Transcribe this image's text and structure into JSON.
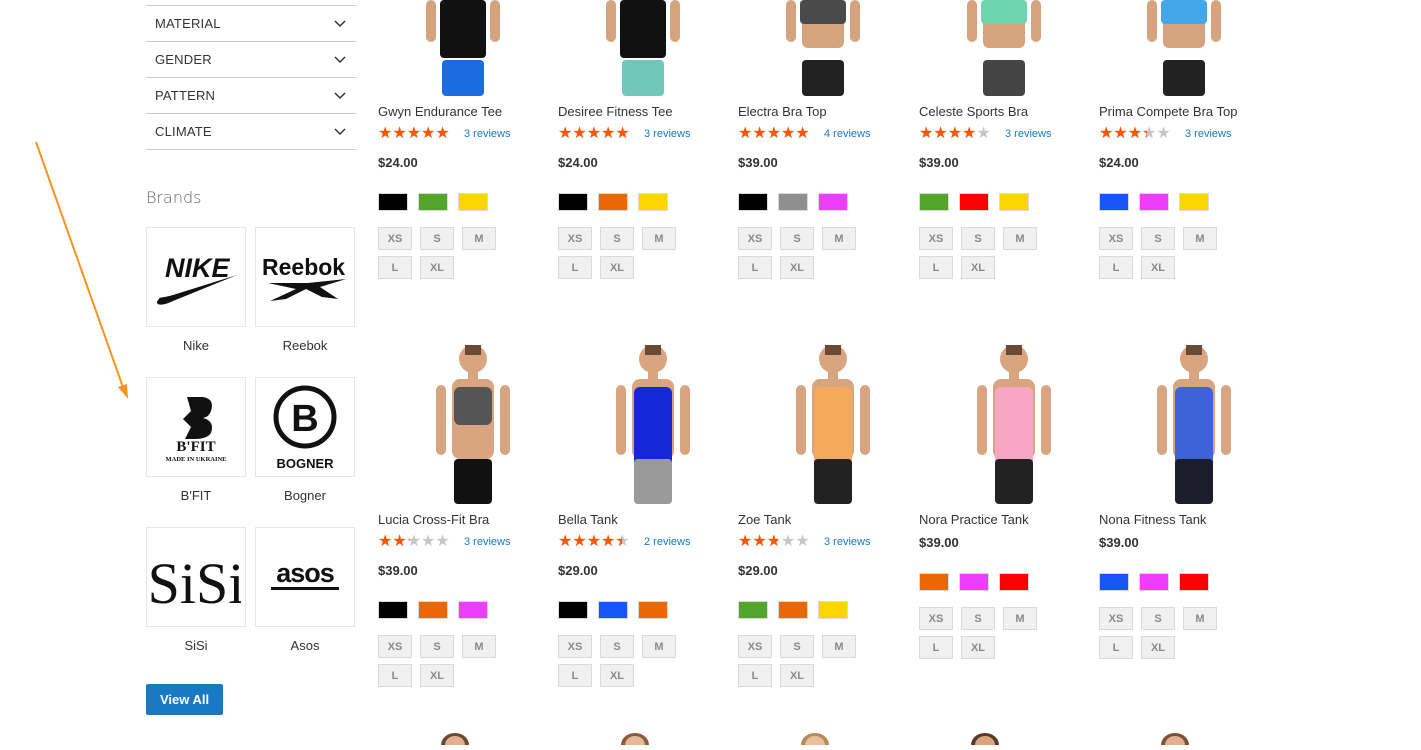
{
  "filters": [
    {
      "label": "MATERIAL"
    },
    {
      "label": "GENDER"
    },
    {
      "label": "PATTERN"
    },
    {
      "label": "CLIMATE"
    }
  ],
  "brands": {
    "title": "Brands",
    "items": [
      {
        "name": "Nike",
        "logo_text": "NIKE"
      },
      {
        "name": "Reebok",
        "logo_text": "Reebok"
      },
      {
        "name": "B'FIT",
        "logo_text": "B'FIT",
        "logo_subtext": "MADE IN UKRAINE"
      },
      {
        "name": "Bogner",
        "logo_text": "BOGNER"
      },
      {
        "name": "SiSi",
        "logo_text": "SiSi"
      },
      {
        "name": "Asos",
        "logo_text": "asos"
      }
    ],
    "view_all": "View All"
  },
  "colors": {
    "accent": "#1979c3",
    "star": "#ff5501",
    "arrow": "#f7931e"
  },
  "products": [
    {
      "name": "Gwyn Endurance Tee",
      "rating": 4.5,
      "reviews": "3 reviews",
      "price": "$24.00",
      "swatches": [
        "#000000",
        "#53a52c",
        "#ffd500"
      ],
      "sizes": [
        "XS",
        "S",
        "M",
        "L",
        "XL"
      ]
    },
    {
      "name": "Desiree Fitness Tee",
      "rating": 4.5,
      "reviews": "3 reviews",
      "price": "$24.00",
      "swatches": [
        "#000000",
        "#eb6703",
        "#ffd500"
      ],
      "sizes": [
        "XS",
        "S",
        "M",
        "L",
        "XL"
      ]
    },
    {
      "name": "Electra Bra Top",
      "rating": 4.5,
      "reviews": "4 reviews",
      "price": "$39.00",
      "swatches": [
        "#000000",
        "#8f8f8f",
        "#ef3dff"
      ],
      "sizes": [
        "XS",
        "S",
        "M",
        "L",
        "XL"
      ]
    },
    {
      "name": "Celeste Sports Bra",
      "rating": 3.5,
      "reviews": "3 reviews",
      "price": "$39.00",
      "swatches": [
        "#53a52c",
        "#ff0000",
        "#ffd500"
      ],
      "sizes": [
        "XS",
        "S",
        "M",
        "L",
        "XL"
      ]
    },
    {
      "name": "Prima Compete Bra Top",
      "rating": 3,
      "reviews": "3 reviews",
      "price": "$24.00",
      "swatches": [
        "#1857f7",
        "#ef3dff",
        "#ffd500"
      ],
      "sizes": [
        "XS",
        "S",
        "M",
        "L",
        "XL"
      ]
    },
    {
      "name": "Lucia Cross-Fit Bra",
      "rating": 2,
      "reviews": "3 reviews",
      "price": "$39.00",
      "swatches": [
        "#000000",
        "#eb6703",
        "#ef3dff"
      ],
      "sizes": [
        "XS",
        "S",
        "M",
        "L",
        "XL"
      ]
    },
    {
      "name": "Bella Tank",
      "rating": 4,
      "reviews": "2 reviews",
      "price": "$29.00",
      "swatches": [
        "#000000",
        "#1857f7",
        "#eb6703"
      ],
      "sizes": [
        "XS",
        "S",
        "M",
        "L",
        "XL"
      ]
    },
    {
      "name": "Zoe Tank",
      "rating": 2.5,
      "reviews": "3 reviews",
      "price": "$29.00",
      "swatches": [
        "#53a52c",
        "#eb6703",
        "#ffd500"
      ],
      "sizes": [
        "XS",
        "S",
        "M",
        "L",
        "XL"
      ]
    },
    {
      "name": "Nora Practice Tank",
      "rating": null,
      "reviews": "",
      "price": "$39.00",
      "swatches": [
        "#eb6703",
        "#ef3dff",
        "#ff0000"
      ],
      "sizes": [
        "XS",
        "S",
        "M",
        "L",
        "XL"
      ]
    },
    {
      "name": "Nona Fitness Tank",
      "rating": null,
      "reviews": "",
      "price": "$39.00",
      "swatches": [
        "#1857f7",
        "#ef3dff",
        "#ff0000"
      ],
      "sizes": [
        "XS",
        "S",
        "M",
        "L",
        "XL"
      ]
    }
  ]
}
